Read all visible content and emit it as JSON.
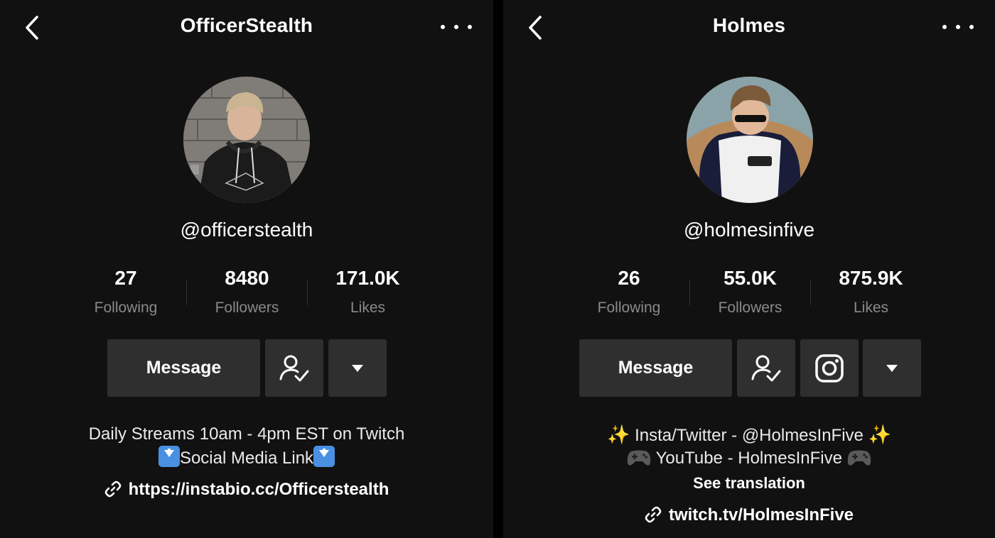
{
  "left_profile": {
    "title": "OfficerStealth",
    "handle": "@officerstealth",
    "stats": [
      {
        "value": "27",
        "label": "Following"
      },
      {
        "value": "8480",
        "label": "Followers"
      },
      {
        "value": "171.0K",
        "label": "Likes"
      }
    ],
    "message_label": "Message",
    "bio_line1": "Daily Streams 10am - 4pm EST on Twitch",
    "bio_line2": "Social Media Link",
    "link": "https://instabio.cc/Officerstealth"
  },
  "right_profile": {
    "title": "Holmes",
    "handle": "@holmesinfive",
    "stats": [
      {
        "value": "26",
        "label": "Following"
      },
      {
        "value": "55.0K",
        "label": "Followers"
      },
      {
        "value": "875.9K",
        "label": "Likes"
      }
    ],
    "message_label": "Message",
    "bio_line1": "Insta/Twitter - @HolmesInFive",
    "bio_line2": "YouTube - HolmesInFive",
    "see_translation": "See translation",
    "link": "twitch.tv/HolmesInFive"
  },
  "icons": [
    "back-chevron-icon",
    "more-dots-icon",
    "friends-check-icon",
    "instagram-icon",
    "dropdown-triangle-icon",
    "link-icon",
    "sparkles-icon",
    "gamepad-icon",
    "down-arrow-emoji-icon"
  ],
  "colors": {
    "background": "#111111",
    "button": "#2f2f2f",
    "muted_text": "#8a8a8a"
  }
}
